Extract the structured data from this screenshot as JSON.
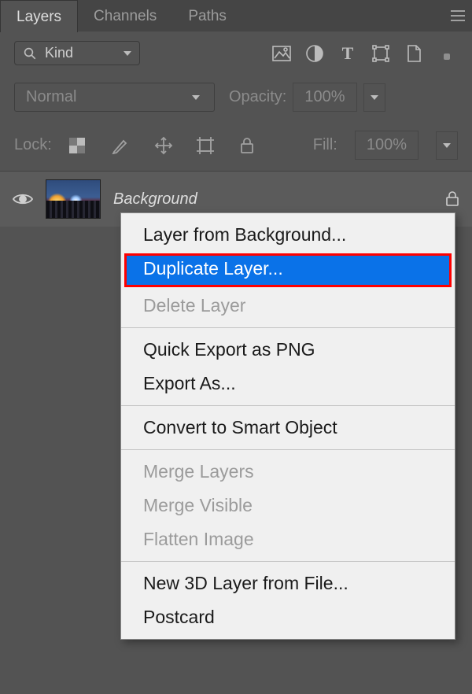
{
  "tabs": {
    "layers": "Layers",
    "channels": "Channels",
    "paths": "Paths"
  },
  "filter": {
    "kind_label": "Kind"
  },
  "icons": {
    "image": "img",
    "adjust": "adj",
    "text": "T",
    "shape": "shape",
    "smart": "smart",
    "dot": "artboard"
  },
  "blend": {
    "mode": "Normal",
    "opacity_label": "Opacity:",
    "opacity_value": "100%"
  },
  "lock": {
    "label": "Lock:",
    "fill_label": "Fill:",
    "fill_value": "100%"
  },
  "layer": {
    "name": "Background"
  },
  "ctx": {
    "items": [
      {
        "label": "Layer from Background...",
        "disabled": false
      },
      {
        "label": "Duplicate Layer...",
        "disabled": false,
        "highlight": true
      },
      {
        "label": "Delete Layer",
        "disabled": true
      },
      {
        "sep": true
      },
      {
        "label": "Quick Export as PNG",
        "disabled": false
      },
      {
        "label": "Export As...",
        "disabled": false
      },
      {
        "sep": true
      },
      {
        "label": "Convert to Smart Object",
        "disabled": false
      },
      {
        "sep": true
      },
      {
        "label": "Merge Layers",
        "disabled": true
      },
      {
        "label": "Merge Visible",
        "disabled": true
      },
      {
        "label": "Flatten Image",
        "disabled": true
      },
      {
        "sep": true
      },
      {
        "label": "New 3D Layer from File...",
        "disabled": false
      },
      {
        "label": "Postcard",
        "disabled": false
      }
    ]
  }
}
